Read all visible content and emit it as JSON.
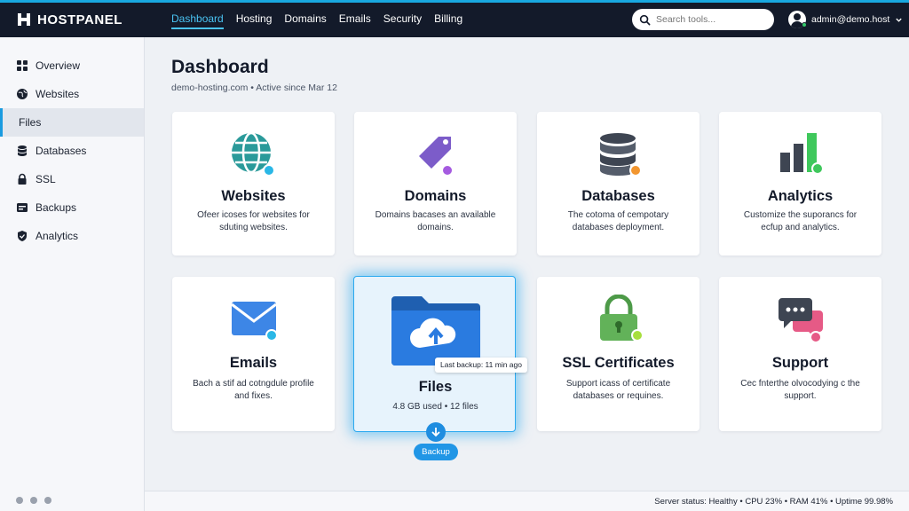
{
  "brand": {
    "name": "HOSTPANEL",
    "icon": "hostpanel-logo-icon"
  },
  "nav": [
    {
      "label": "Dashboard",
      "active": true
    },
    {
      "label": "Hosting",
      "active": false
    },
    {
      "label": "Domains",
      "active": false
    },
    {
      "label": "Emails",
      "active": false
    },
    {
      "label": "Security",
      "active": false
    },
    {
      "label": "Billing",
      "active": false
    }
  ],
  "search": {
    "placeholder": "Search tools..."
  },
  "user": {
    "email": "admin@demo.host"
  },
  "sidebar": {
    "items": [
      {
        "label": "Overview",
        "icon": "grid-icon"
      },
      {
        "label": "Websites",
        "icon": "globe-icon"
      },
      {
        "label": "Files",
        "icon": "file-icon",
        "active": true
      },
      {
        "label": "Databases",
        "icon": "database-icon"
      },
      {
        "label": "SSL",
        "icon": "lock-icon"
      },
      {
        "label": "Backups",
        "icon": "backup-icon"
      },
      {
        "label": "Analytics",
        "icon": "shield-icon"
      }
    ]
  },
  "page": {
    "title": "Dashboard",
    "subtitle": "demo-hosting.com • Active since Mar 12"
  },
  "cards": [
    {
      "title": "Websites",
      "desc": "Ofeer icoses for websites for sduting websites.",
      "icon": "globe-icon"
    },
    {
      "title": "Domains",
      "desc": "Domains bacases an available domains.",
      "icon": "tag-icon"
    },
    {
      "title": "Databases",
      "desc": "The cotoma of cempotary databases deployment.",
      "icon": "database-icon"
    },
    {
      "title": "Analytics",
      "desc": "Customize the suporancs for ecfup and analytics.",
      "icon": "bar-chart-icon"
    },
    {
      "title": "Emails",
      "desc": "Bach a stif ad cotngdule profile and fixes.",
      "icon": "envelope-icon"
    },
    {
      "title": "Files",
      "desc": "4.8 GB used • 12 files",
      "icon": "cloud-upload-folder-icon",
      "tooltip": "Last backup: 11 min ago",
      "button": "Backup"
    },
    {
      "title": "SSL Certificates",
      "desc": "Support icass of certificate databases or requines.",
      "icon": "padlock-icon"
    },
    {
      "title": "Support",
      "desc": "Cec fnterthe olvocodying c the support.",
      "icon": "chat-icon"
    }
  ],
  "status": {
    "text": "Server status: Healthy • CPU 23% • RAM 41% • Uptime 99.98%"
  },
  "colors": {
    "header": "#131a2a",
    "accent": "#18a8e0",
    "highlight": "#2ba9ef"
  }
}
